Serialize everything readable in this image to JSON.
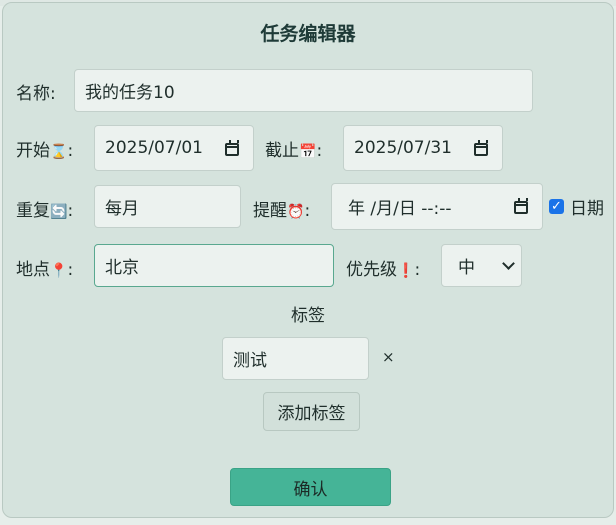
{
  "dialog": {
    "title": "任务编辑器"
  },
  "form": {
    "name": {
      "label": "名称:",
      "value": "我的任务10"
    },
    "start": {
      "label": "开始",
      "emoji": "⌛",
      "colon": ":",
      "value": "2025/07/01"
    },
    "due": {
      "label": "截止",
      "emoji": "📅",
      "colon": ":",
      "value": "2025/07/31"
    },
    "repeat": {
      "label": "重复",
      "emoji": "🔄",
      "colon": ":",
      "value": "每月"
    },
    "reminder": {
      "label": "提醒",
      "emoji": "⏰",
      "colon": ":",
      "value": "年 /月/日 --:--"
    },
    "date_only": {
      "label": "日期",
      "checked": true
    },
    "location": {
      "label": "地点",
      "emoji": "📍",
      "colon": ":",
      "value": "北京"
    },
    "priority": {
      "label": "优先级",
      "emoji": "❗",
      "colon": ":",
      "value": "中"
    },
    "tags": {
      "heading": "标签",
      "items": [
        {
          "value": "测试",
          "remove": "×"
        }
      ],
      "add_label": "添加标签"
    }
  },
  "actions": {
    "confirm_label": "确认"
  }
}
